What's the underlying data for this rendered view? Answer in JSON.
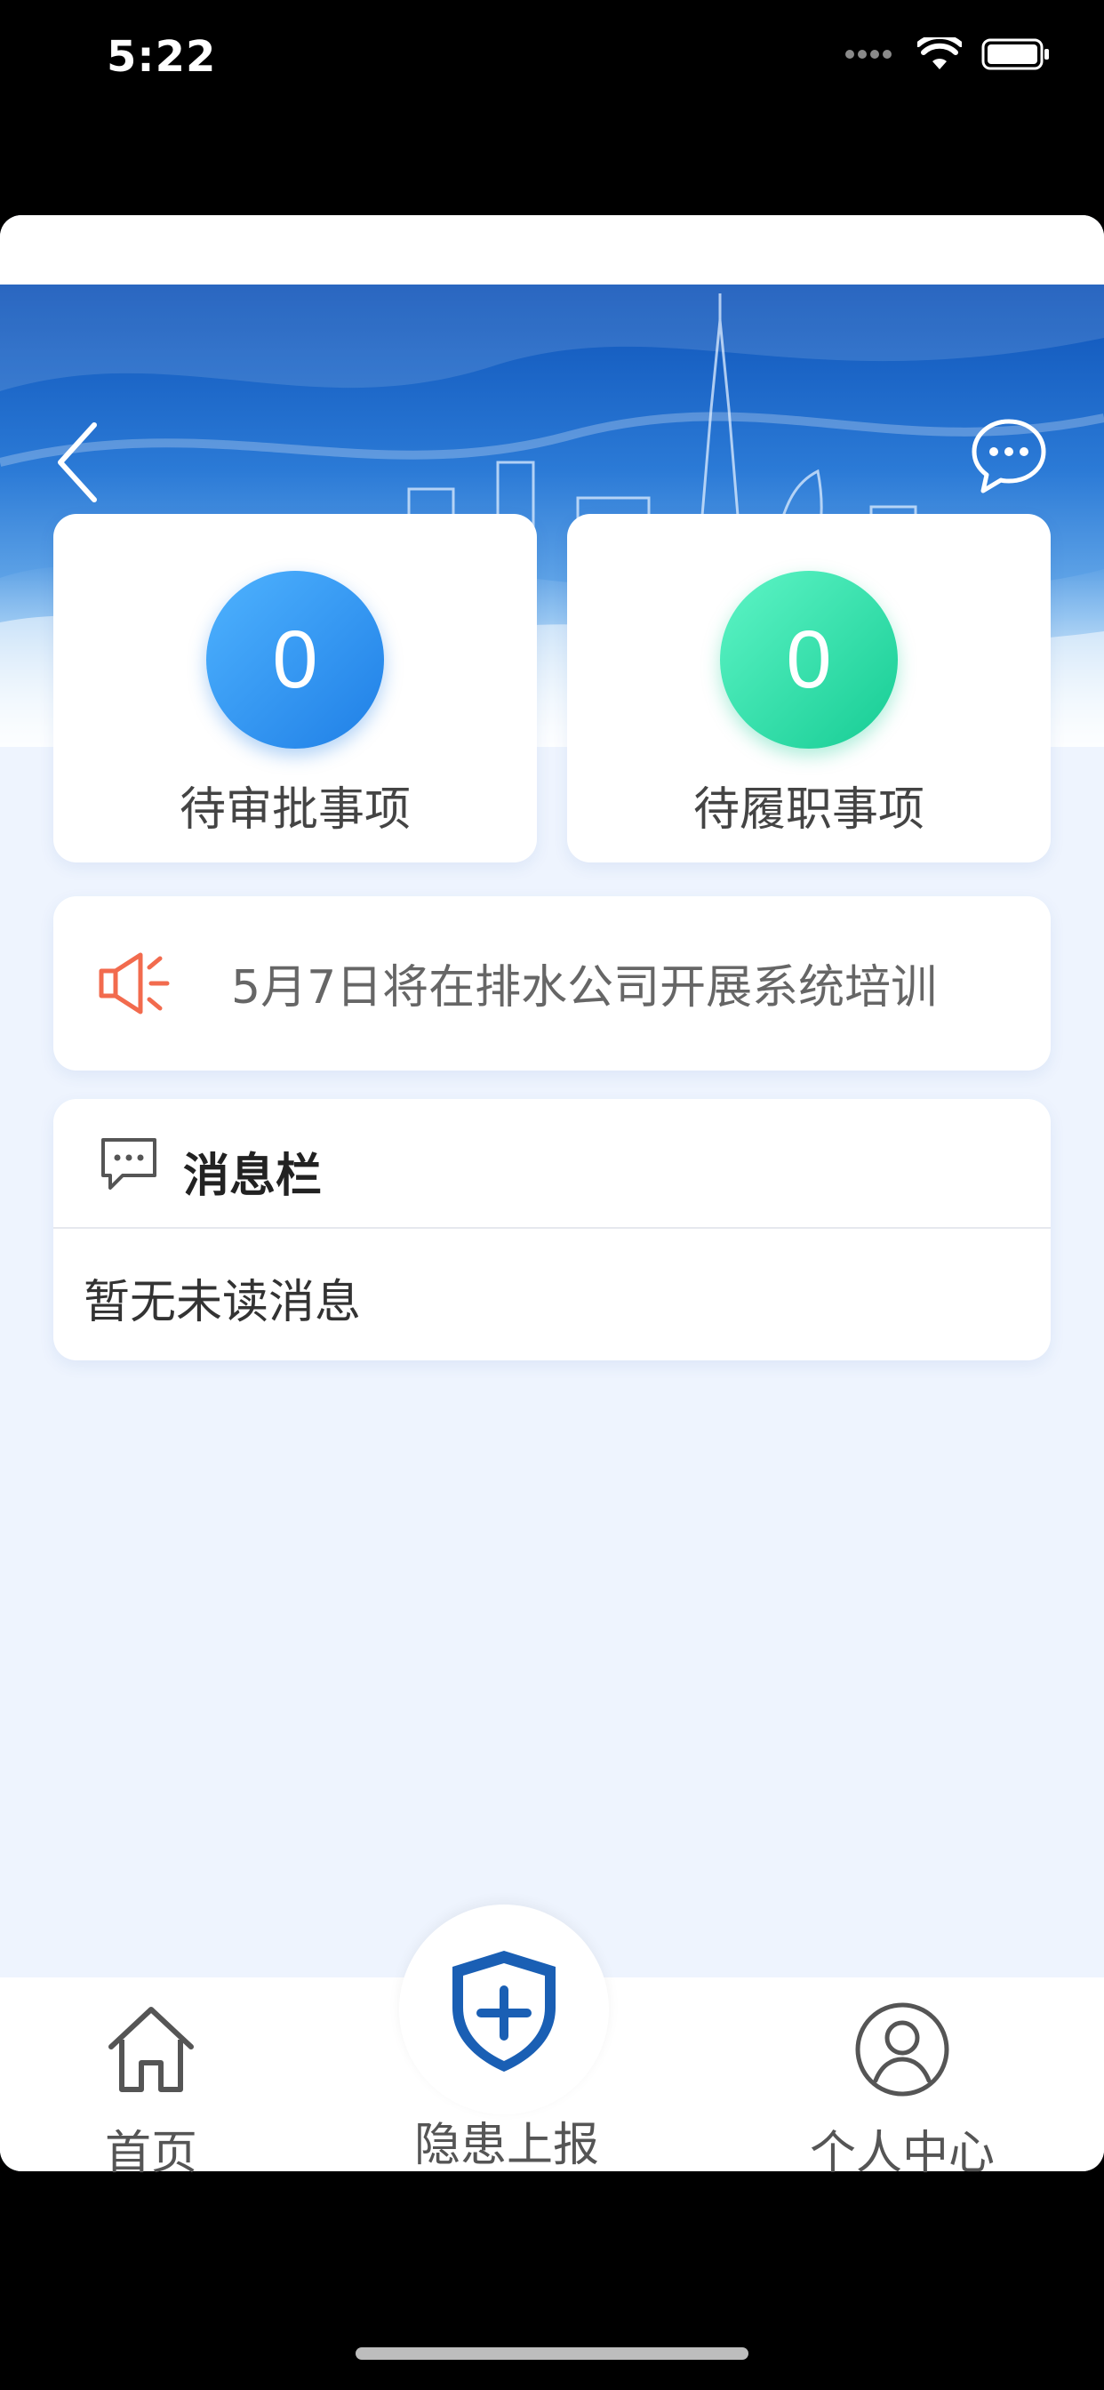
{
  "status_bar": {
    "time": "5:22"
  },
  "header": {
    "back_icon": "chevron-left-icon",
    "message_icon": "chat-bubble-icon"
  },
  "stats": [
    {
      "value": "0",
      "label": "待审批事项",
      "color": "#2b8ef0"
    },
    {
      "value": "0",
      "label": "待履职事项",
      "color": "#25dca6"
    }
  ],
  "notice": {
    "icon": "megaphone-icon",
    "text": "5月7日将在排水公司开展系统培训",
    "icon_color": "#f26b4e"
  },
  "messages": {
    "title": "消息栏",
    "empty_text": "暂无未读消息"
  },
  "tabbar": {
    "items": [
      {
        "label": "首页",
        "icon": "home-icon"
      },
      {
        "label": "隐患上报",
        "icon": "shield-plus-icon"
      },
      {
        "label": "个人中心",
        "icon": "user-circle-icon"
      }
    ],
    "accent": "#1a5fb4"
  }
}
